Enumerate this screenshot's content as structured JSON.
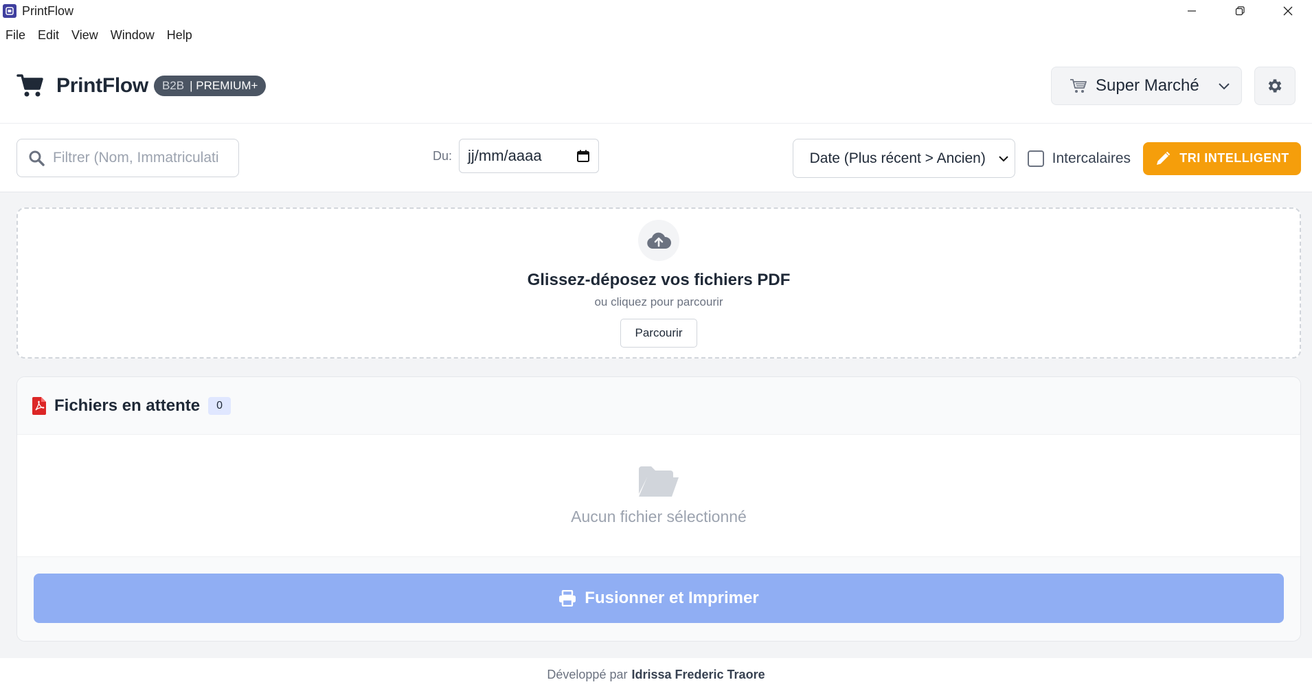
{
  "window": {
    "title": "PrintFlow"
  },
  "menu": {
    "items": [
      "File",
      "Edit",
      "View",
      "Window",
      "Help"
    ]
  },
  "header": {
    "brand": "PrintFlow",
    "badge_tier": "B2B",
    "badge_plan": "| PREMIUM+",
    "store_select": "Super Marché"
  },
  "toolbar": {
    "search_placeholder": "Filtrer (Nom, Immatriculation...)",
    "search_visible": "Filtrer (Nom, Immatriculati",
    "date_label": "Du:",
    "date_placeholder": "jj/mm/aaaa",
    "sort_value": "Date (Plus récent > Ancien)",
    "checkbox_label": "Intercalaires",
    "smart_sort_label": "TRI INTELLIGENT"
  },
  "dropzone": {
    "title": "Glissez-déposez vos fichiers PDF",
    "subtitle": "ou cliquez pour parcourir",
    "button": "Parcourir"
  },
  "files": {
    "title": "Fichiers en attente",
    "count": "0",
    "empty": "Aucun fichier sélectionné",
    "merge_button": "Fusionner et Imprimer"
  },
  "footer": {
    "prefix": "Développé par",
    "author": "Idrissa Frederic Traore"
  },
  "colors": {
    "accent_orange": "#f59e0b",
    "merge_blue_disabled": "#90aef3",
    "pdf_red": "#dc2626"
  }
}
